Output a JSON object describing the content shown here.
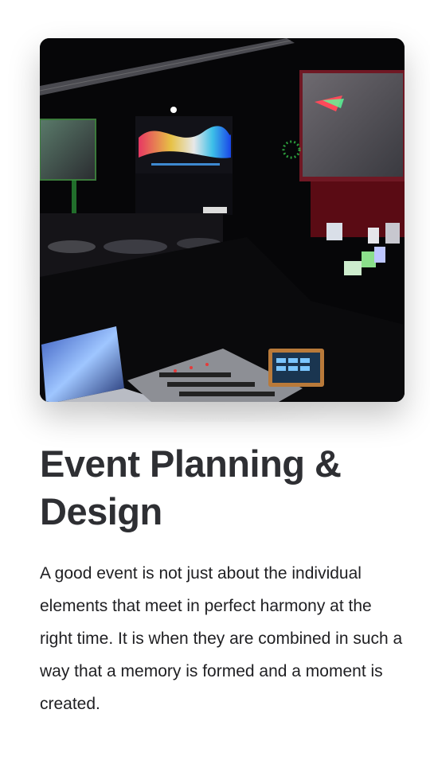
{
  "hero_image": {
    "description_icon": "event-stage-photo",
    "alt": "Event Planning & Design"
  },
  "section": {
    "title": "Event Planning & Design",
    "body": "A good event is not just about the individual elements that meet in perfect harmony at the right time. It is when they are combined in such a way that a memory is formed and a moment is created."
  },
  "colors": {
    "title": "#2e2f33",
    "body": "#1f1f22",
    "background": "#ffffff"
  }
}
